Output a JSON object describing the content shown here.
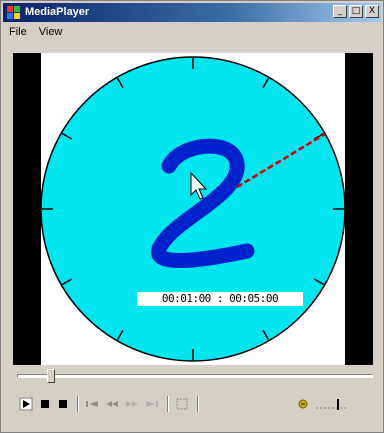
{
  "window": {
    "title": "MediaPlayer",
    "buttons": {
      "minimize": "_",
      "maximize": "□",
      "close": "X"
    }
  },
  "menu": {
    "items": [
      {
        "label": "File"
      },
      {
        "label": "View"
      }
    ]
  },
  "video": {
    "timecode": "00:01:00 : 00:05:00",
    "digit": "2",
    "colors": {
      "clock_face": "#00e5ee",
      "digit": "#0022cc",
      "hand": "#cc0000",
      "border": "#000000"
    }
  },
  "playback": {
    "position_fraction": 0.2
  },
  "controls": {
    "icons": [
      "play-icon",
      "pause-icon",
      "stop-icon",
      "previous-icon",
      "rewind-icon",
      "fast-forward-icon",
      "next-icon",
      "fullscreen-icon",
      "volume-icon"
    ]
  },
  "volume": {
    "level_fraction": 0.7
  }
}
